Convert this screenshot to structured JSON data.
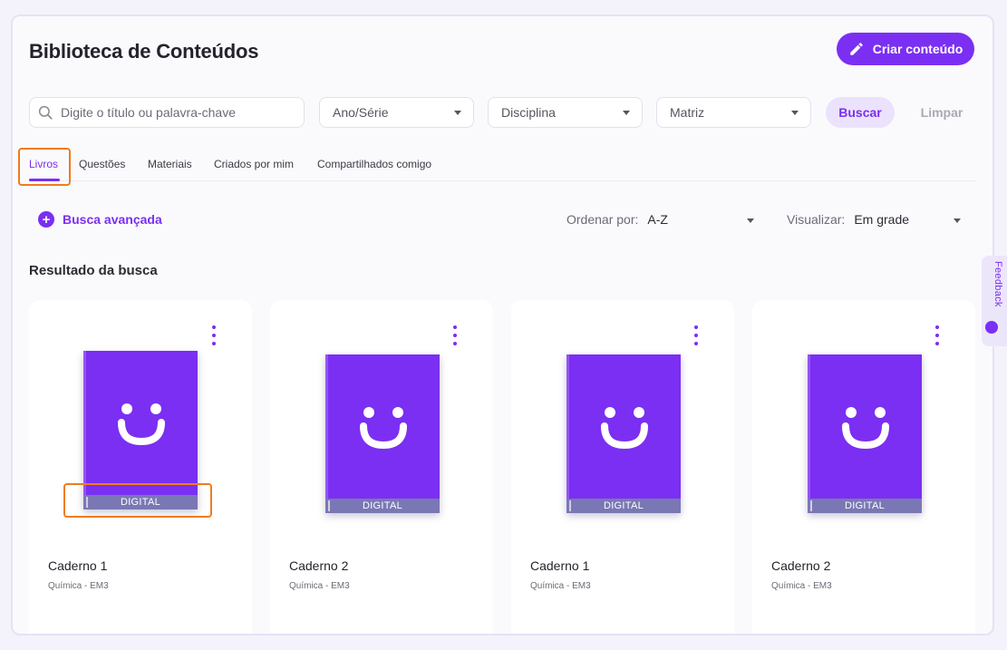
{
  "header": {
    "title": "Biblioteca de Conteúdos",
    "create_button": "Criar conteúdo"
  },
  "filters": {
    "search_placeholder": "Digite o título ou palavra-chave",
    "ano_serie": "Ano/Série",
    "disciplina": "Disciplina",
    "matriz": "Matriz",
    "search_button": "Buscar",
    "clear_button": "Limpar"
  },
  "tabs": [
    {
      "label": "Livros",
      "active": true
    },
    {
      "label": "Questões"
    },
    {
      "label": "Materiais"
    },
    {
      "label": "Criados por mim"
    },
    {
      "label": "Compartilhados comigo"
    }
  ],
  "toolbar": {
    "advanced_search": "Busca avançada",
    "sort_label": "Ordenar por:",
    "sort_value": "A-Z",
    "view_label": "Visualizar:",
    "view_value": "Em grade"
  },
  "results": {
    "title": "Resultado da busca",
    "items": [
      {
        "title": "Caderno 1",
        "subtitle": "Química - EM3",
        "badge": "DIGITAL"
      },
      {
        "title": "Caderno 2",
        "subtitle": "Química - EM3",
        "badge": "DIGITAL"
      },
      {
        "title": "Caderno 1",
        "subtitle": "Química - EM3",
        "badge": "DIGITAL"
      },
      {
        "title": "Caderno 2",
        "subtitle": "Química - EM3",
        "badge": "DIGITAL"
      }
    ]
  },
  "feedback": {
    "label": "Feedback"
  },
  "colors": {
    "accent": "#7b2ff2",
    "accent_light": "#ebe2fd",
    "band": "#7a78b4",
    "highlight": "#f07c1c"
  }
}
